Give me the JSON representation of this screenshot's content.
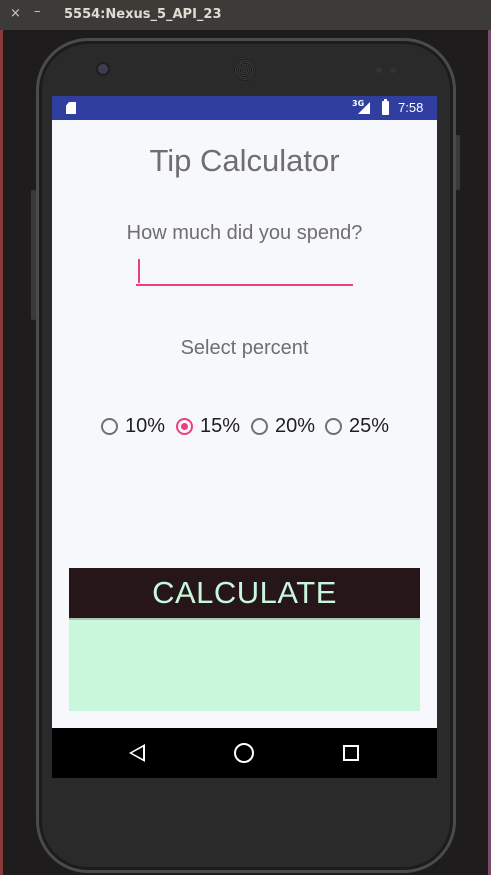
{
  "window": {
    "title": "5554:Nexus_5_API_23",
    "close_glyph": "×",
    "minimize_glyph": "–"
  },
  "statusbar": {
    "network": "3G",
    "time": "7:58"
  },
  "app": {
    "title": "Tip Calculator",
    "question": "How much did you spend?",
    "amount_value": "",
    "select_label": "Select percent",
    "percent_options": [
      "10%",
      "15%",
      "20%",
      "25%"
    ],
    "selected_percent": "15%",
    "calculate_label": "CALCULATE",
    "result_text": ""
  },
  "colors": {
    "accent": "#ec407a",
    "statusbar": "#303f9f",
    "button_bg": "#261619",
    "button_text": "#c8f7dc",
    "result_bg": "#c8f7dc"
  },
  "icons": {
    "statusbar": [
      "sd-card-icon",
      "signal-icon",
      "battery-icon"
    ],
    "navbar": [
      "back-icon",
      "home-icon",
      "recents-icon"
    ]
  }
}
